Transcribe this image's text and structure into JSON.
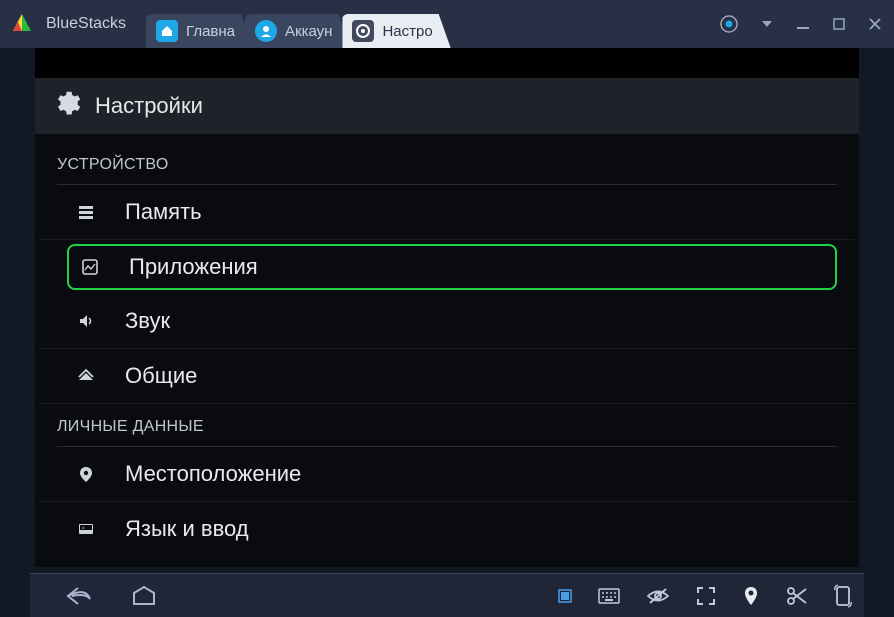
{
  "app": {
    "name": "BlueStacks"
  },
  "tabs": [
    {
      "label": "Главна",
      "icon": "home-icon"
    },
    {
      "label": "Аккаун",
      "icon": "user-icon"
    },
    {
      "label": "Настро",
      "icon": "gear-icon",
      "active": true
    }
  ],
  "settings": {
    "title": "Настройки",
    "sections": [
      {
        "title": "УСТРОЙСТВО",
        "items": [
          {
            "label": "Память",
            "icon": "storage-icon"
          },
          {
            "label": "Приложения",
            "icon": "apps-icon",
            "highlight": true
          },
          {
            "label": "Звук",
            "icon": "sound-icon"
          },
          {
            "label": "Общие",
            "icon": "home2-icon"
          }
        ]
      },
      {
        "title": "ЛИЧНЫЕ ДАННЫЕ",
        "items": [
          {
            "label": "Местоположение",
            "icon": "location-icon"
          },
          {
            "label": "Язык и ввод",
            "icon": "language-icon"
          }
        ]
      }
    ]
  }
}
